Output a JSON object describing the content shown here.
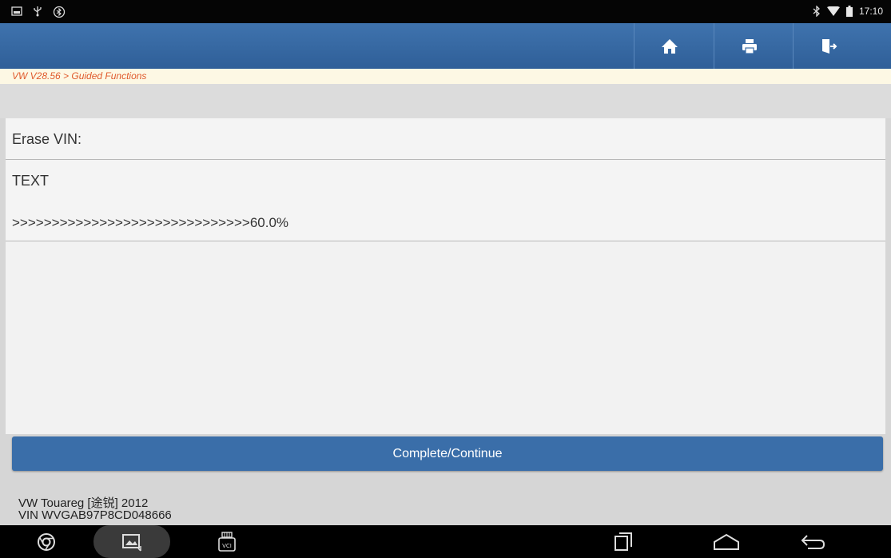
{
  "status_bar": {
    "time": "17:10",
    "left_icons": [
      "screenshot-icon",
      "usb-icon",
      "bluetooth-badge-icon"
    ],
    "right_icons": [
      "bluetooth-icon",
      "wifi-icon",
      "battery-icon"
    ]
  },
  "toolbar": {
    "buttons": [
      {
        "name": "home-button",
        "icon": "home-icon"
      },
      {
        "name": "print-button",
        "icon": "printer-icon"
      },
      {
        "name": "exit-button",
        "icon": "exit-icon"
      }
    ]
  },
  "breadcrumb": "VW V28.56 > Guided Functions",
  "content": {
    "title": "Erase VIN:",
    "message_label": "TEXT",
    "progress_text": ">>>>>>>>>>>>>>>>>>>>>>>>>>>>>>60.0%"
  },
  "action": {
    "continue_label": "Complete/Continue"
  },
  "vehicle": {
    "model_line": "VW Touareg [途锐] 2012",
    "vin_line": "VIN WVGAB97P8CD048666"
  },
  "nav_bar": {
    "vci_label": "VCI",
    "icons": [
      "chrome-icon",
      "gallery-icon",
      "vci-icon",
      "recent-apps-icon",
      "home-nav-icon",
      "back-icon"
    ]
  },
  "colors": {
    "toolbar": "#3a6ea9",
    "breadcrumb_text": "#e05a2c",
    "button": "#3a6ea9"
  }
}
